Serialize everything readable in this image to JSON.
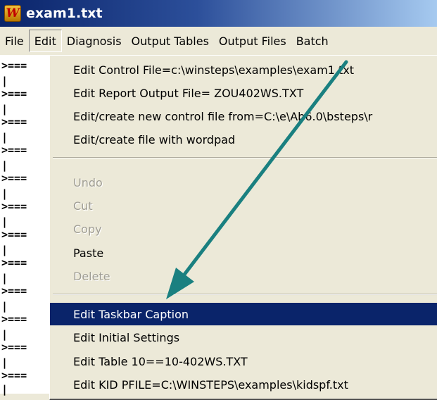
{
  "window": {
    "title": "exam1.txt",
    "icon": "winsteps-w-icon",
    "icon_letter": "W"
  },
  "menubar": {
    "items": [
      {
        "label": "File"
      },
      {
        "label": "Edit"
      },
      {
        "label": "Diagnosis"
      },
      {
        "label": "Output Tables"
      },
      {
        "label": "Output Files"
      },
      {
        "label": "Batch"
      }
    ],
    "active_index": 1
  },
  "document": {
    "lines": [
      ">===",
      "|",
      ">===",
      "|",
      ">===",
      "|",
      ">===",
      "|",
      ">===",
      "|",
      ">===",
      "|",
      ">===",
      "|",
      ">===",
      "|",
      ">===",
      "|",
      ">===",
      "|",
      ">===",
      "|",
      ">===",
      "|"
    ]
  },
  "edit_menu": {
    "items": [
      {
        "label": "Edit Control File=c:\\winsteps\\examples\\exam1.txt",
        "enabled": true
      },
      {
        "label": "Edit Report Output File= ZOU402WS.TXT",
        "enabled": true
      },
      {
        "label": "Edit/create new control file from=C:\\e\\Ab6.0\\bsteps\\r",
        "enabled": true
      },
      {
        "label": "Edit/create file with wordpad",
        "enabled": true
      },
      {
        "label": "Undo",
        "enabled": false
      },
      {
        "label": "Cut",
        "enabled": false
      },
      {
        "label": "Copy",
        "enabled": false
      },
      {
        "label": "Paste",
        "enabled": true
      },
      {
        "label": "Delete",
        "enabled": false
      },
      {
        "label": "Edit Taskbar Caption",
        "enabled": true,
        "selected": true
      },
      {
        "label": "Edit Initial Settings",
        "enabled": true
      },
      {
        "label": "Edit Table 10==10-402WS.TXT",
        "enabled": true
      },
      {
        "label": "Edit KID PFILE=C:\\WINSTEPS\\examples\\kidspf.txt",
        "enabled": true
      }
    ]
  },
  "annotation": {
    "arrow_color": "#1a8080"
  },
  "colors": {
    "titlebar": "#0a246a",
    "menu_bg": "#ece9d8",
    "highlight": "#0a246a"
  }
}
